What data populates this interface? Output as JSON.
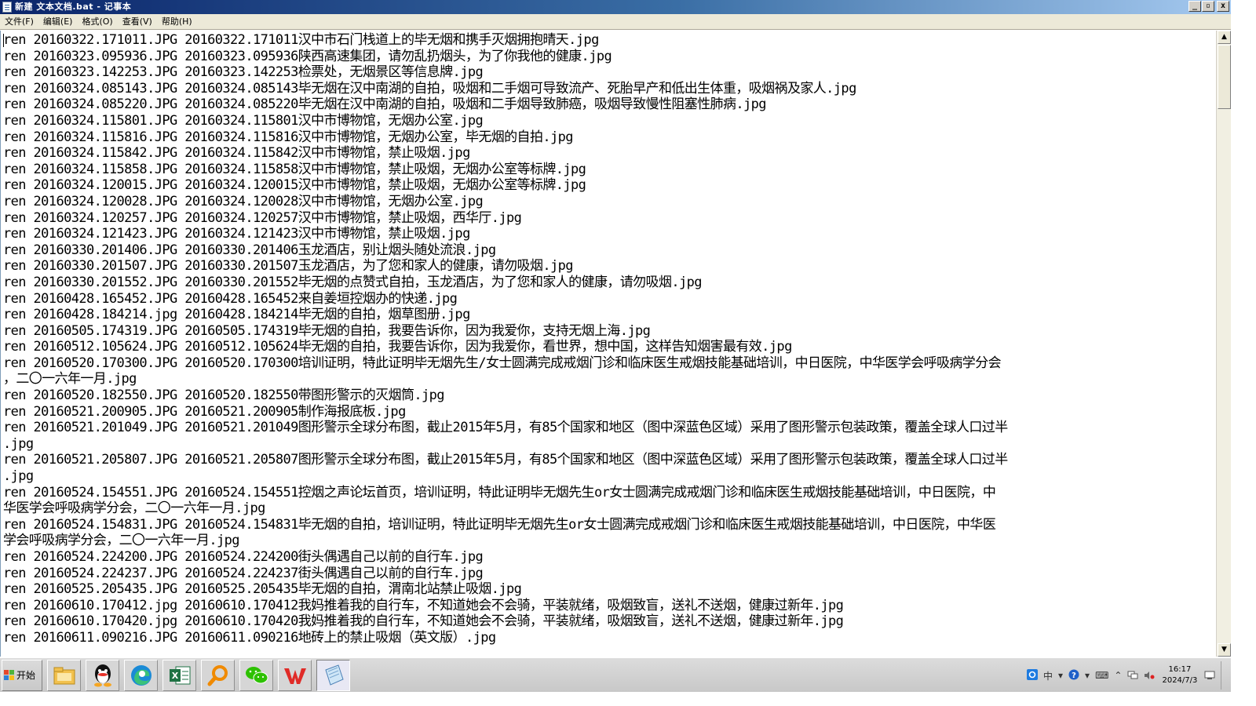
{
  "window": {
    "title": "新建 文本文档.bat - 记事本",
    "minimize": "_",
    "maximize": "▫",
    "close": "x"
  },
  "menu": {
    "items": [
      "文件(F)",
      "编辑(E)",
      "格式(O)",
      "查看(V)",
      "帮助(H)"
    ]
  },
  "editor": {
    "lines": [
      "ren 20160322.171011.JPG 20160322.171011汉中市石门栈道上的毕无烟和携手灭烟拥抱晴天.jpg",
      "ren 20160323.095936.JPG 20160323.095936陕西高速集团，请勿乱扔烟头，为了你我他的健康.jpg",
      "ren 20160323.142253.JPG 20160323.142253检票处，无烟景区等信息牌.jpg",
      "ren 20160324.085143.JPG 20160324.085143毕无烟在汉中南湖的自拍，吸烟和二手烟可导致流产、死胎早产和低出生体重，吸烟祸及家人.jpg",
      "ren 20160324.085220.JPG 20160324.085220毕无烟在汉中南湖的自拍，吸烟和二手烟导致肺癌，吸烟导致慢性阻塞性肺病.jpg",
      "ren 20160324.115801.JPG 20160324.115801汉中市博物馆，无烟办公室.jpg",
      "ren 20160324.115816.JPG 20160324.115816汉中市博物馆，无烟办公室，毕无烟的自拍.jpg",
      "ren 20160324.115842.JPG 20160324.115842汉中市博物馆，禁止吸烟.jpg",
      "ren 20160324.115858.JPG 20160324.115858汉中市博物馆，禁止吸烟，无烟办公室等标牌.jpg",
      "ren 20160324.120015.JPG 20160324.120015汉中市博物馆，禁止吸烟，无烟办公室等标牌.jpg",
      "ren 20160324.120028.JPG 20160324.120028汉中市博物馆，无烟办公室.jpg",
      "ren 20160324.120257.JPG 20160324.120257汉中市博物馆，禁止吸烟，西华厅.jpg",
      "ren 20160324.121423.JPG 20160324.121423汉中市博物馆，禁止吸烟.jpg",
      "ren 20160330.201406.JPG 20160330.201406玉龙酒店，别让烟头随处流浪.jpg",
      "ren 20160330.201507.JPG 20160330.201507玉龙酒店，为了您和家人的健康，请勿吸烟.jpg",
      "ren 20160330.201552.JPG 20160330.201552毕无烟的点赞式自拍，玉龙酒店，为了您和家人的健康，请勿吸烟.jpg",
      "ren 20160428.165452.JPG 20160428.165452来自姜垣控烟办的快递.jpg",
      "ren 20160428.184214.jpg 20160428.184214毕无烟的自拍，烟草图册.jpg",
      "ren 20160505.174319.JPG 20160505.174319毕无烟的自拍，我要告诉你，因为我爱你，支持无烟上海.jpg",
      "ren 20160512.105624.JPG 20160512.105624毕无烟的自拍，我要告诉你，因为我爱你，看世界，想中国，这样告知烟害最有效.jpg",
      "ren 20160520.170300.JPG 20160520.170300培训证明，特此证明毕无烟先生/女士圆满完成戒烟门诊和临床医生戒烟技能基础培训，中日医院，中华医学会呼吸病学分会",
      "，二〇一六年一月.jpg",
      "ren 20160520.182550.JPG 20160520.182550带图形警示的灭烟筒.jpg",
      "ren 20160521.200905.JPG 20160521.200905制作海报底板.jpg",
      "ren 20160521.201049.JPG 20160521.201049图形警示全球分布图，截止2015年5月，有85个国家和地区（图中深蓝色区域）采用了图形警示包装政策，覆盖全球人口过半",
      ".jpg",
      "ren 20160521.205807.JPG 20160521.205807图形警示全球分布图，截止2015年5月，有85个国家和地区（图中深蓝色区域）采用了图形警示包装政策，覆盖全球人口过半",
      ".jpg",
      "ren 20160524.154551.JPG 20160524.154551控烟之声论坛首页，培训证明，特此证明毕无烟先生or女士圆满完成戒烟门诊和临床医生戒烟技能基础培训，中日医院，中",
      "华医学会呼吸病学分会，二〇一六年一月.jpg",
      "ren 20160524.154831.JPG 20160524.154831毕无烟的自拍，培训证明，特此证明毕无烟先生or女士圆满完成戒烟门诊和临床医生戒烟技能基础培训，中日医院，中华医",
      "学会呼吸病学分会，二〇一六年一月.jpg",
      "ren 20160524.224200.JPG 20160524.224200街头偶遇自己以前的自行车.jpg",
      "ren 20160524.224237.JPG 20160524.224237街头偶遇自己以前的自行车.jpg",
      "ren 20160525.205435.JPG 20160525.205435毕无烟的自拍，渭南北站禁止吸烟.jpg",
      "ren 20160610.170412.jpg 20160610.170412我妈推着我的自行车，不知道她会不会骑，平装就绪，吸烟致盲，送礼不送烟，健康过新年.jpg",
      "ren 20160610.170420.jpg 20160610.170420我妈推着我的自行车，不知道她会不会骑，平装就绪，吸烟致盲，送礼不送烟，健康过新年.jpg",
      "ren 20160611.090216.JPG 20160611.090216地砖上的禁止吸烟（英文版）.jpg"
    ]
  },
  "taskbar": {
    "start_label": "开始",
    "icons": [
      "file-explorer-icon",
      "qq-icon",
      "edge-icon",
      "excel-icon",
      "search-magnifier-icon",
      "wechat-icon",
      "wps-icon",
      "notepad-icon"
    ],
    "tray_ime": "中",
    "clock_time": "16:17",
    "clock_date": "2024/7/3"
  },
  "colors": {
    "title_start": "#0a246a",
    "title_end": "#a6caf0",
    "menu_bg": "#ece9d8",
    "text": "#000000"
  }
}
